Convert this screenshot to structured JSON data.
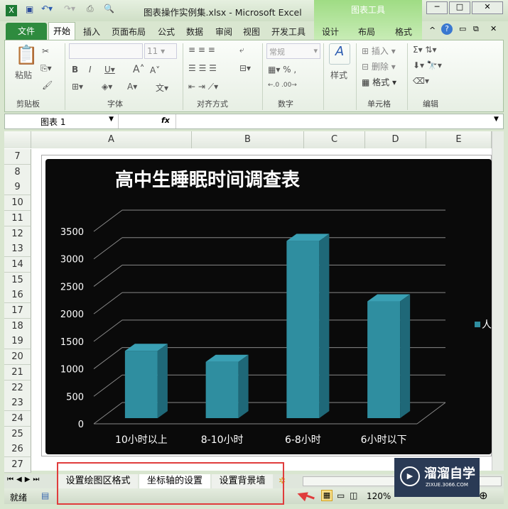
{
  "window": {
    "title": "图表操作实例集.xlsx - Microsoft Excel",
    "context_tab": "图表工具"
  },
  "tabs": [
    "开始",
    "插入",
    "页面布局",
    "公式",
    "数据",
    "审阅",
    "视图",
    "开发工具",
    "设计",
    "布局",
    "格式"
  ],
  "file_tab": "文件",
  "ribbon": {
    "groups": [
      "剪贴板",
      "字体",
      "对齐方式",
      "数字",
      "样式",
      "单元格",
      "编辑"
    ],
    "paste": "粘贴",
    "font_size": "11",
    "number_format": "常规",
    "style_label": "样式",
    "insert": "插入",
    "delete": "删除",
    "format": "格式"
  },
  "formula_bar": {
    "name_box": "图表 1",
    "fx": "fx",
    "value": ""
  },
  "columns": [
    "A",
    "B",
    "C",
    "D",
    "E"
  ],
  "rows": [
    "7",
    "8",
    "9",
    "10",
    "11",
    "12",
    "13",
    "14",
    "15",
    "16",
    "17",
    "18",
    "19",
    "20",
    "21",
    "22",
    "23",
    "24",
    "25",
    "26",
    "27"
  ],
  "chart_data": {
    "type": "bar",
    "title": "高中生睡眠时间调查表",
    "categories": [
      "10小时以上",
      "8-10小时",
      "6-8小时",
      "6小时以下"
    ],
    "series": [
      {
        "name": "人",
        "values": [
          1250,
          1050,
          3250,
          2150
        ]
      }
    ],
    "yticks": [
      "0",
      "500",
      "1000",
      "1500",
      "2000",
      "2500",
      "3000",
      "3500"
    ],
    "ylim": [
      0,
      3500
    ],
    "legend": "right",
    "grid": true,
    "bar_color": "#2f8ea0"
  },
  "sheet_tabs": [
    "设置绘图区格式",
    "坐标轴的设置",
    "设置背景墙"
  ],
  "active_sheet": 1,
  "status": {
    "ready": "就绪",
    "zoom": "120%"
  },
  "watermark": {
    "name": "溜溜自学",
    "url": "ZIXUE.3066.COM"
  }
}
